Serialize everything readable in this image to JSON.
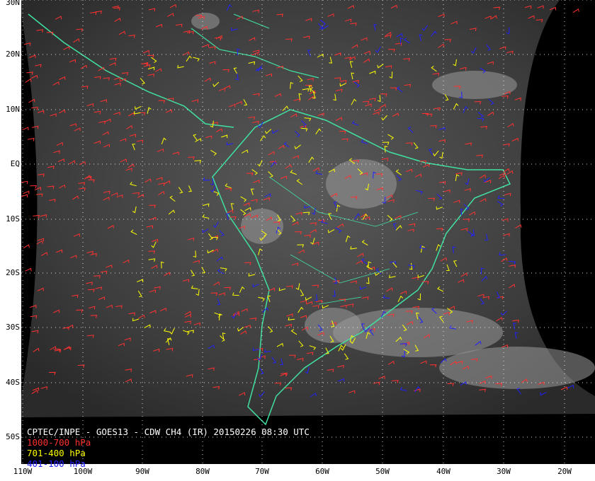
{
  "caption": {
    "title": "CPTEC/INPE - GOES13 - CDW CH4 (IR) 20150226 08:30 UTC",
    "legend": [
      {
        "label": "1000-700 hPa",
        "color": "#ff3030"
      },
      {
        "label": "701-400 hPa",
        "color": "#ffff00"
      },
      {
        "label": "401-100 hPa",
        "color": "#0000ff"
      }
    ]
  },
  "axes": {
    "lat_labels": [
      "30N",
      "20N",
      "10N",
      "EQ",
      "10S",
      "20S",
      "30S",
      "40S",
      "50S"
    ],
    "lon_labels": [
      "110W",
      "100W",
      "90W",
      "80W",
      "70W",
      "60W",
      "50W",
      "40W",
      "30W",
      "20W"
    ]
  },
  "colors": {
    "coastline": "#40e0a0",
    "grid": "#ffffff",
    "background": "#000000"
  }
}
